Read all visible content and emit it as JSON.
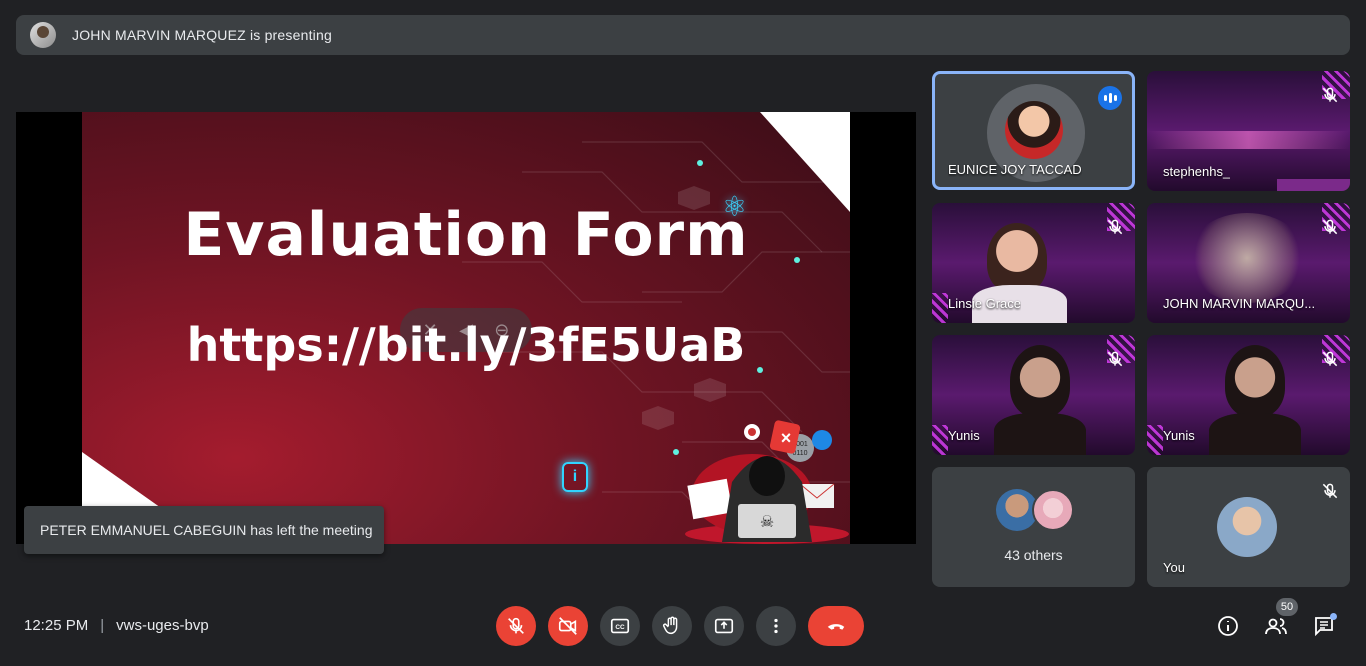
{
  "presenting": {
    "text": "JOHN MARVIN MARQUEZ is presenting"
  },
  "slide": {
    "title": "Evaluation Form",
    "url": "https://bit.ly/3fE5UaB"
  },
  "toast": {
    "text": "PETER EMMANUEL CABEGUIN has left the meeting"
  },
  "participants": [
    {
      "name": "EUNICE JOY TACCAD",
      "active": true
    },
    {
      "name": "stephenhs_",
      "muted": true
    },
    {
      "name": "Linsie Grace",
      "muted": true
    },
    {
      "name": "JOHN MARVIN MARQU...",
      "muted": true
    },
    {
      "name": "Yunis",
      "muted": true
    },
    {
      "name": "Yunis",
      "muted": true
    },
    {
      "name": "43 others"
    },
    {
      "name": "You",
      "muted": true
    }
  ],
  "meeting": {
    "time": "12:25 PM",
    "code": "vws-uges-bvp"
  },
  "people_count": "50",
  "colors": {
    "background": "#202124",
    "surface": "#3c4043",
    "danger": "#ea4335",
    "active_border": "#8ab4f8"
  },
  "icons": [
    "mic-off-icon",
    "camera-off-icon",
    "captions-icon",
    "raise-hand-icon",
    "present-icon",
    "more-icon",
    "hang-up-icon",
    "info-icon",
    "people-icon",
    "chat-icon"
  ]
}
